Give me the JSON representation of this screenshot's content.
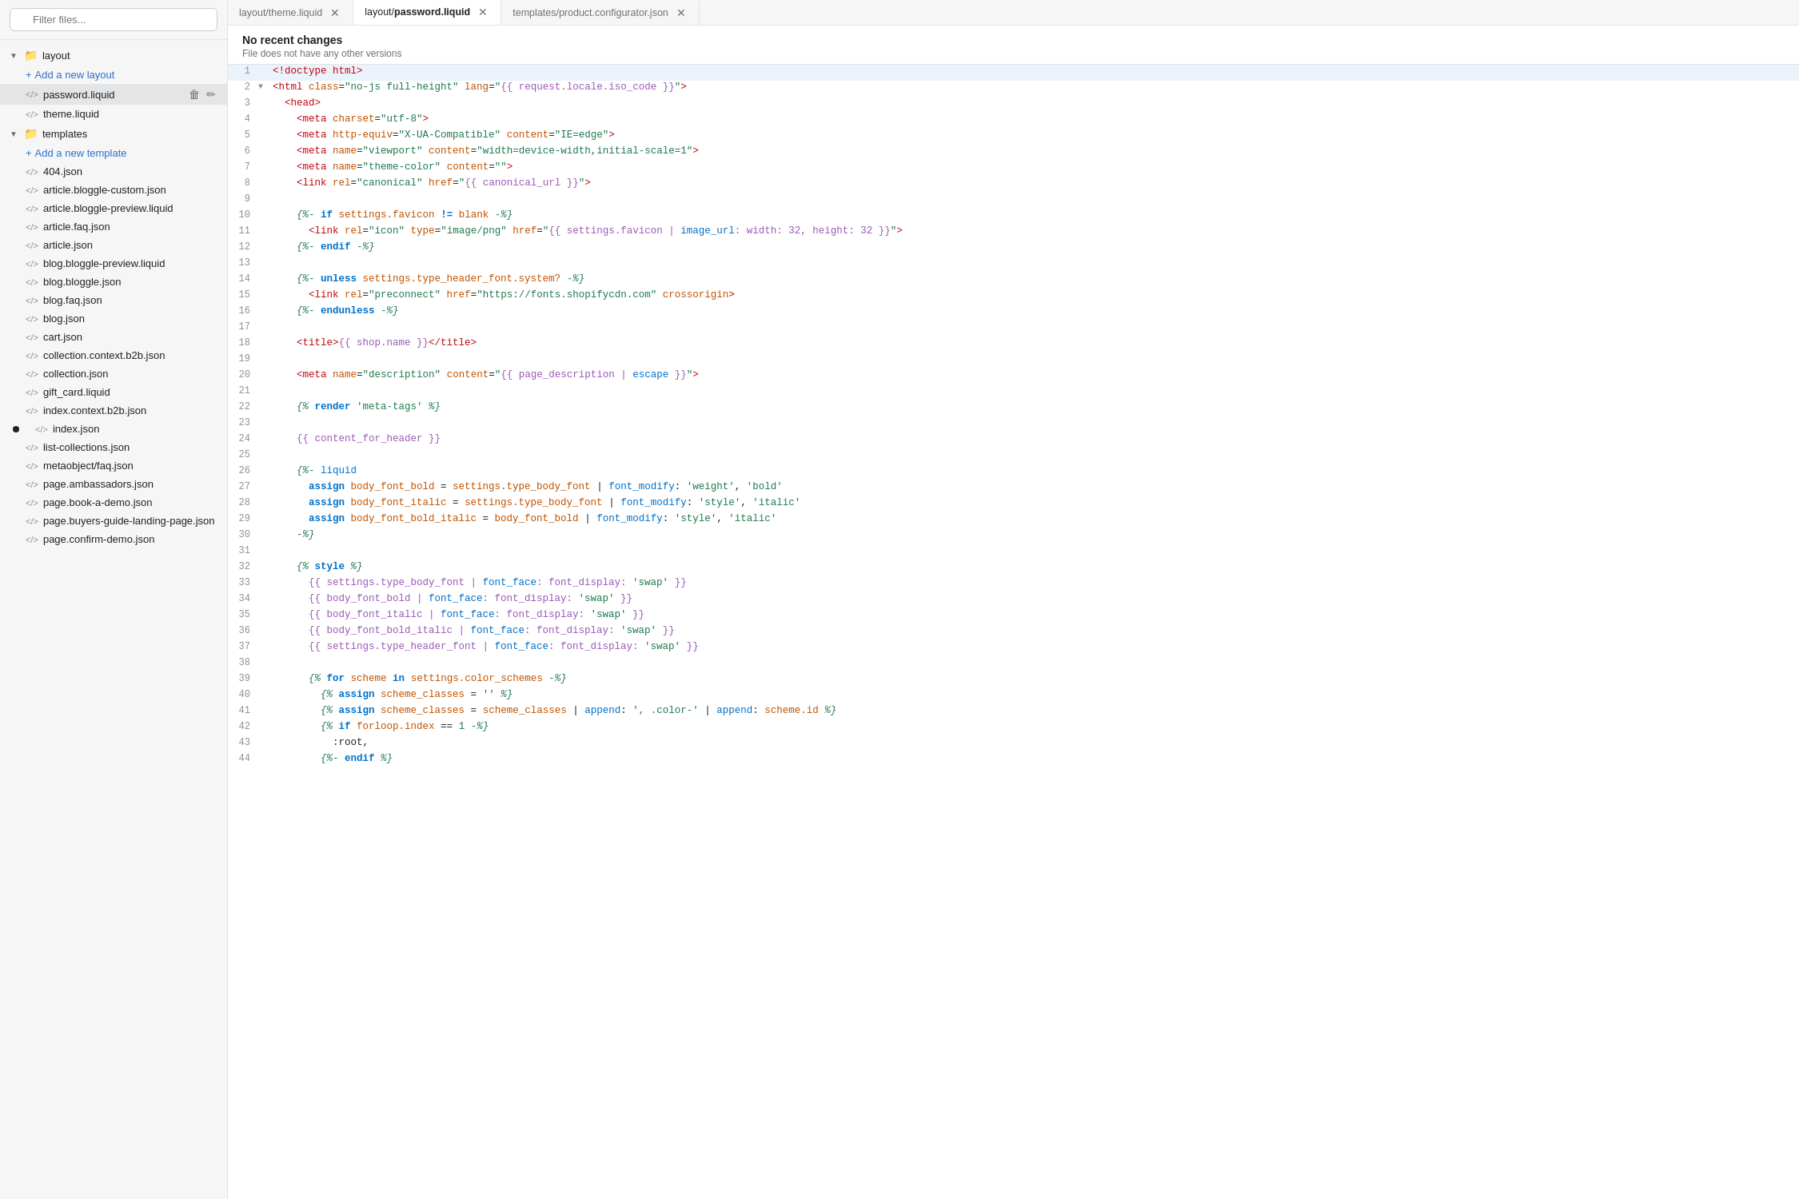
{
  "sidebar": {
    "filter_placeholder": "Filter files...",
    "layout_folder": {
      "label": "layout",
      "add_label": "Add a new layout",
      "files": [
        {
          "name": "password.liquid",
          "active": true,
          "has_actions": true
        },
        {
          "name": "theme.liquid",
          "active": false,
          "has_actions": false
        }
      ]
    },
    "templates_folder": {
      "label": "templates",
      "add_label": "Add a new template",
      "files": [
        {
          "name": "404.json",
          "active": false,
          "dot": false
        },
        {
          "name": "article.bloggle-custom.json",
          "active": false,
          "dot": false
        },
        {
          "name": "article.bloggle-preview.liquid",
          "active": false,
          "dot": false
        },
        {
          "name": "article.faq.json",
          "active": false,
          "dot": false
        },
        {
          "name": "article.json",
          "active": false,
          "dot": false
        },
        {
          "name": "blog.bloggle-preview.liquid",
          "active": false,
          "dot": false
        },
        {
          "name": "blog.bloggle.json",
          "active": false,
          "dot": false
        },
        {
          "name": "blog.faq.json",
          "active": false,
          "dot": false
        },
        {
          "name": "blog.json",
          "active": false,
          "dot": false
        },
        {
          "name": "cart.json",
          "active": false,
          "dot": false
        },
        {
          "name": "collection.context.b2b.json",
          "active": false,
          "dot": false
        },
        {
          "name": "collection.json",
          "active": false,
          "dot": false
        },
        {
          "name": "gift_card.liquid",
          "active": false,
          "dot": false
        },
        {
          "name": "index.context.b2b.json",
          "active": false,
          "dot": false
        },
        {
          "name": "index.json",
          "active": false,
          "dot": true
        },
        {
          "name": "list-collections.json",
          "active": false,
          "dot": false
        },
        {
          "name": "metaobject/faq.json",
          "active": false,
          "dot": false
        },
        {
          "name": "page.ambassadors.json",
          "active": false,
          "dot": false
        },
        {
          "name": "page.book-a-demo.json",
          "active": false,
          "dot": false
        },
        {
          "name": "page.buyers-guide-landing-page.json",
          "active": false,
          "dot": false
        },
        {
          "name": "page.confirm-demo.json",
          "active": false,
          "dot": false
        }
      ]
    }
  },
  "tabs": [
    {
      "id": "tab1",
      "label": "layout/theme.liquid",
      "active": false
    },
    {
      "id": "tab2",
      "label_pre": "layout/",
      "label_bold": "password.liquid",
      "active": true
    },
    {
      "id": "tab3",
      "label": "templates/product.configurator.json",
      "active": false
    }
  ],
  "status": {
    "title": "No recent changes",
    "subtitle": "File does not have any other versions"
  },
  "code": {
    "lines": [
      {
        "num": 1,
        "arrow": "",
        "content": "<!doctype html>"
      },
      {
        "num": 2,
        "arrow": "▼",
        "content": "<html class=\"no-js full-height\" lang=\"{{ request.locale.iso_code }}\">"
      },
      {
        "num": 3,
        "arrow": "",
        "content": "  <head>"
      },
      {
        "num": 4,
        "arrow": "",
        "content": "    <meta charset=\"utf-8\">"
      },
      {
        "num": 5,
        "arrow": "",
        "content": "    <meta http-equiv=\"X-UA-Compatible\" content=\"IE=edge\">"
      },
      {
        "num": 6,
        "arrow": "",
        "content": "    <meta name=\"viewport\" content=\"width=device-width,initial-scale=1\">"
      },
      {
        "num": 7,
        "arrow": "",
        "content": "    <meta name=\"theme-color\" content=\"\">"
      },
      {
        "num": 8,
        "arrow": "",
        "content": "    <link rel=\"canonical\" href=\"{{ canonical_url }}\">"
      },
      {
        "num": 9,
        "arrow": "",
        "content": ""
      },
      {
        "num": 10,
        "arrow": "",
        "content": "    {%- if settings.favicon != blank -%}"
      },
      {
        "num": 11,
        "arrow": "",
        "content": "      <link rel=\"icon\" type=\"image/png\" href=\"{{ settings.favicon | image_url: width: 32, height: 32 }}\">"
      },
      {
        "num": 12,
        "arrow": "",
        "content": "    {%- endif -%}"
      },
      {
        "num": 13,
        "arrow": "",
        "content": ""
      },
      {
        "num": 14,
        "arrow": "",
        "content": "    {%- unless settings.type_header_font.system? -%}"
      },
      {
        "num": 15,
        "arrow": "",
        "content": "      <link rel=\"preconnect\" href=\"https://fonts.shopifycdn.com\" crossorigin>"
      },
      {
        "num": 16,
        "arrow": "",
        "content": "    {%- endunless -%}"
      },
      {
        "num": 17,
        "arrow": "",
        "content": ""
      },
      {
        "num": 18,
        "arrow": "",
        "content": "    <title>{{ shop.name }}</title>"
      },
      {
        "num": 19,
        "arrow": "",
        "content": ""
      },
      {
        "num": 20,
        "arrow": "",
        "content": "    <meta name=\"description\" content=\"{{ page_description | escape }}\">"
      },
      {
        "num": 21,
        "arrow": "",
        "content": ""
      },
      {
        "num": 22,
        "arrow": "",
        "content": "    {% render 'meta-tags' %}"
      },
      {
        "num": 23,
        "arrow": "",
        "content": ""
      },
      {
        "num": 24,
        "arrow": "",
        "content": "    {{ content_for_header }}"
      },
      {
        "num": 25,
        "arrow": "",
        "content": ""
      },
      {
        "num": 26,
        "arrow": "",
        "content": "    {%- liquid"
      },
      {
        "num": 27,
        "arrow": "",
        "content": "      assign body_font_bold = settings.type_body_font | font_modify: 'weight', 'bold'"
      },
      {
        "num": 28,
        "arrow": "",
        "content": "      assign body_font_italic = settings.type_body_font | font_modify: 'style', 'italic'"
      },
      {
        "num": 29,
        "arrow": "",
        "content": "      assign body_font_bold_italic = body_font_bold | font_modify: 'style', 'italic'"
      },
      {
        "num": 30,
        "arrow": "",
        "content": "    -%}"
      },
      {
        "num": 31,
        "arrow": "",
        "content": ""
      },
      {
        "num": 32,
        "arrow": "",
        "content": "    {% style %}"
      },
      {
        "num": 33,
        "arrow": "",
        "content": "      {{ settings.type_body_font | font_face: font_display: 'swap' }}"
      },
      {
        "num": 34,
        "arrow": "",
        "content": "      {{ body_font_bold | font_face: font_display: 'swap' }}"
      },
      {
        "num": 35,
        "arrow": "",
        "content": "      {{ body_font_italic | font_face: font_display: 'swap' }}"
      },
      {
        "num": 36,
        "arrow": "",
        "content": "      {{ body_font_bold_italic | font_face: font_display: 'swap' }}"
      },
      {
        "num": 37,
        "arrow": "",
        "content": "      {{ settings.type_header_font | font_face: font_display: 'swap' }}"
      },
      {
        "num": 38,
        "arrow": "",
        "content": ""
      },
      {
        "num": 39,
        "arrow": "",
        "content": "      {% for scheme in settings.color_schemes -%}"
      },
      {
        "num": 40,
        "arrow": "",
        "content": "        {% assign scheme_classes = '' %}"
      },
      {
        "num": 41,
        "arrow": "",
        "content": "        {% assign scheme_classes = scheme_classes | append: ', .color-' | append: scheme.id %}"
      },
      {
        "num": 42,
        "arrow": "",
        "content": "        {% if forloop.index == 1 -%}"
      },
      {
        "num": 43,
        "arrow": "",
        "content": "          :root,"
      },
      {
        "num": 44,
        "arrow": "",
        "content": "        {%- endif %}"
      }
    ]
  }
}
